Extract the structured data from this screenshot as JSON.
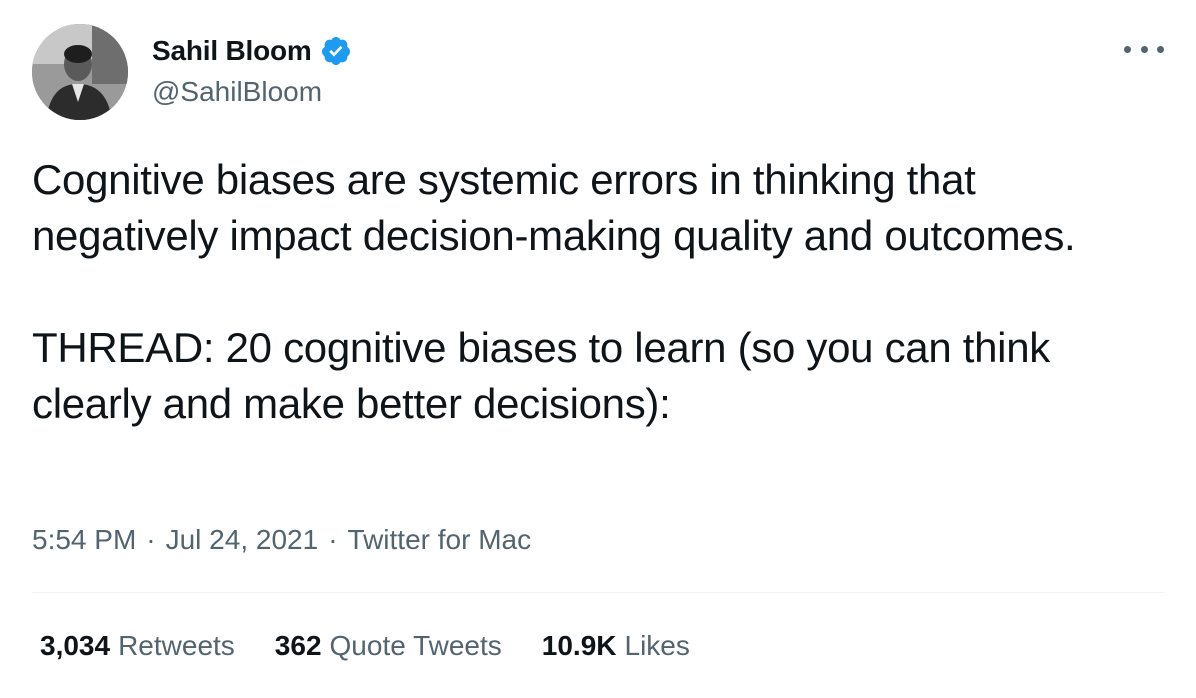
{
  "author": {
    "display_name": "Sahil Bloom",
    "handle": "@SahilBloom",
    "verified": true,
    "avatar_icon": "profile-photo"
  },
  "tweet": {
    "text": "Cognitive biases are systemic errors in thinking that negatively impact decision-making quality and outcomes.\n\nTHREAD: 20 cognitive biases to learn (so you can think clearly and make better decisions):",
    "time": "5:54 PM",
    "date": "Jul 24, 2021",
    "source": "Twitter for Mac",
    "separator": "·"
  },
  "stats": {
    "retweets": {
      "count": "3,034",
      "label": "Retweets"
    },
    "quote_tweets": {
      "count": "362",
      "label": "Quote Tweets"
    },
    "likes": {
      "count": "10.9K",
      "label": "Likes"
    }
  },
  "icons": {
    "verified": "verified-badge-icon",
    "more": "more-options-icon"
  },
  "colors": {
    "text_primary": "#0f1419",
    "text_secondary": "#536471",
    "verified_blue": "#1d9bf0",
    "divider": "#eff3f4"
  }
}
